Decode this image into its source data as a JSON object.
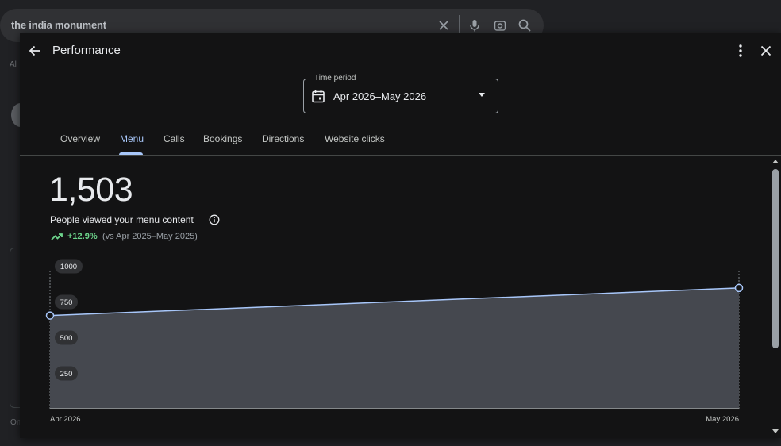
{
  "background": {
    "search_query": "the india monument",
    "left_text_1": "Al",
    "left_text_2": "On"
  },
  "header": {
    "title": "Performance"
  },
  "time_period": {
    "label": "Time period",
    "value": "Apr 2026–May 2026"
  },
  "tabs": [
    {
      "label": "Overview"
    },
    {
      "label": "Menu",
      "active": true
    },
    {
      "label": "Calls"
    },
    {
      "label": "Bookings"
    },
    {
      "label": "Directions"
    },
    {
      "label": "Website clicks"
    }
  ],
  "metric": {
    "value": "1,503",
    "label": "People viewed your menu content",
    "change": "+12.9%",
    "comparison": "(vs Apr 2025–May 2025)"
  },
  "colors": {
    "accent": "#a8c7fa",
    "positive": "#6dd58c",
    "area_fill": "#45484f"
  },
  "chart_data": {
    "type": "area",
    "x": [
      "Apr 2026",
      "May 2026"
    ],
    "values": [
      655,
      848
    ],
    "y_ticks": [
      "250",
      "500",
      "750",
      "1000"
    ],
    "ylim": [
      0,
      1000
    ],
    "grid": false
  }
}
